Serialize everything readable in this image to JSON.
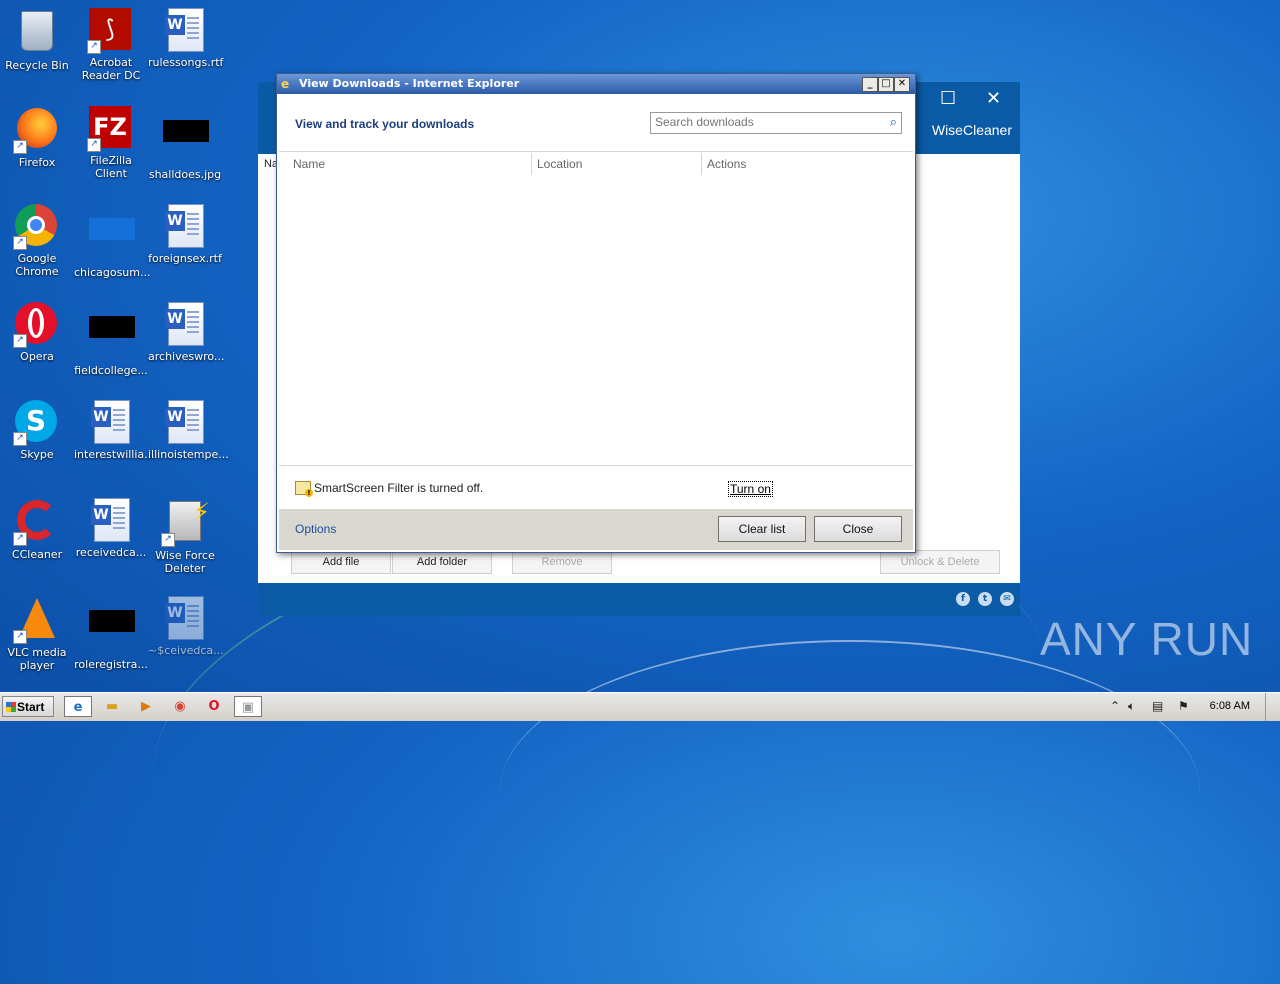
{
  "desktop": {
    "icons": [
      {
        "label": "Recycle Bin"
      },
      {
        "label": "Acrobat Reader DC"
      },
      {
        "label": "rulessongs.rtf"
      },
      {
        "label": "Firefox"
      },
      {
        "label": "FileZilla Client"
      },
      {
        "label": "shalldoes.jpg"
      },
      {
        "label": "Google Chrome"
      },
      {
        "label": "chicagosum..."
      },
      {
        "label": "foreignsex.rtf"
      },
      {
        "label": "Opera"
      },
      {
        "label": "fieldcollege..."
      },
      {
        "label": "archiveswro..."
      },
      {
        "label": "Skype"
      },
      {
        "label": "interestwillia..."
      },
      {
        "label": "illinoistempe..."
      },
      {
        "label": "CCleaner"
      },
      {
        "label": "receivedca..."
      },
      {
        "label": "Wise Force Deleter"
      },
      {
        "label": "VLC media player"
      },
      {
        "label": "roleregistra..."
      },
      {
        "label": "~$ceivedca..."
      }
    ]
  },
  "wise_window": {
    "brand": "WiseCleaner",
    "column_stub": "Na",
    "buttons": {
      "add_file": "Add file",
      "add_folder": "Add folder",
      "remove": "Remove",
      "unlock_delete": "Unlock & Delete"
    }
  },
  "dialog": {
    "title": "View Downloads - Internet Explorer",
    "heading": "View and track your downloads",
    "search_placeholder": "Search downloads",
    "columns": [
      "Name",
      "Location",
      "Actions"
    ],
    "smartscreen_text": "SmartScreen Filter is turned off.",
    "turn_on_label": "Turn on",
    "options_label": "Options",
    "clear_list_label": "Clear list",
    "close_label": "Close"
  },
  "taskbar": {
    "start_label": "Start",
    "clock": "6:08 AM"
  },
  "watermark": "ANY RUN"
}
